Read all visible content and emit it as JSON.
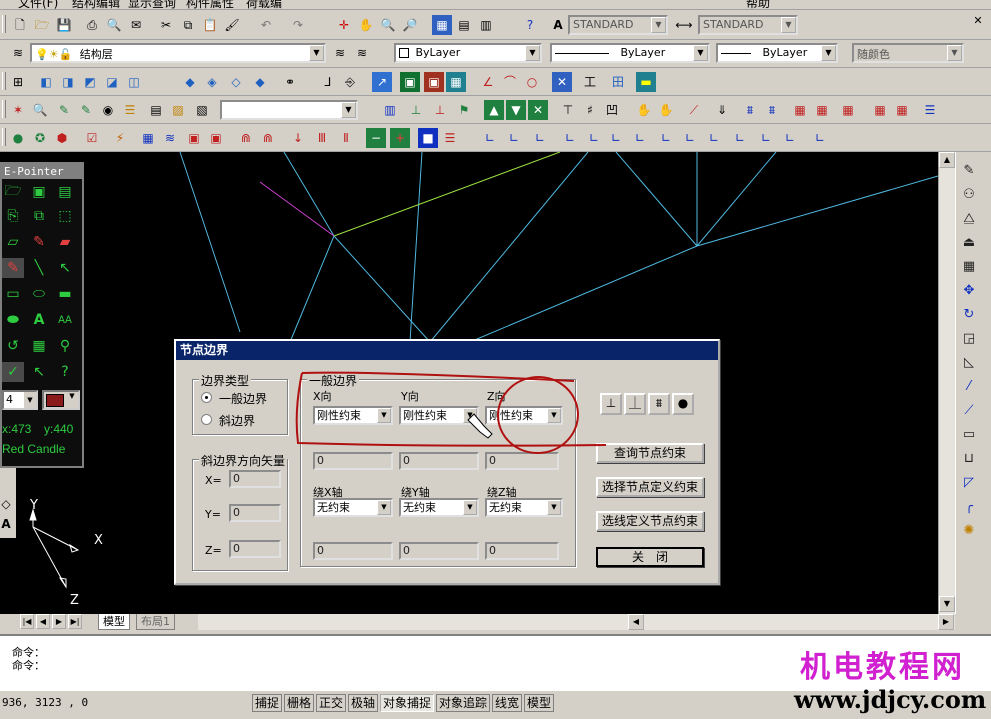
{
  "menubar": {
    "items": [
      "文件(F)",
      "结构编辑",
      "显示查询",
      "构件属性",
      "荷载编",
      "帮助"
    ]
  },
  "toolbar1": {
    "text_style": "STANDARD",
    "dim_style": "STANDARD"
  },
  "toolbar2": {
    "layer": "结构层",
    "color": "ByLayer",
    "linetype": "ByLayer",
    "lineweight": "ByLayer",
    "plotstyle": "随颜色"
  },
  "epointer": {
    "title": "E-Pointer",
    "size_value": "4",
    "coord_x": "x:473",
    "coord_y": "y:440",
    "color_name": "Red Candle"
  },
  "ucs": {
    "x": "X",
    "y": "Y",
    "z": "Z"
  },
  "layout_tabs": [
    "模型",
    "布局1"
  ],
  "command": {
    "line1": "命令：",
    "line2": "命令："
  },
  "status": {
    "coords": "936,    3123 ,  0",
    "buttons": [
      "捕捉",
      "栅格",
      "正交",
      "极轴",
      "对象捕捉",
      "对象追踪",
      "线宽",
      "模型"
    ]
  },
  "dialog": {
    "title": "节点边界",
    "boundary_type": {
      "label": "边界类型",
      "options": [
        "一般边界",
        "斜边界"
      ],
      "selected": "一般边界"
    },
    "vector": {
      "label": "斜边界方向矢量",
      "x_label": "X=",
      "y_label": "Y=",
      "z_label": "Z=",
      "x": "0",
      "y": "0",
      "z": "0"
    },
    "general": {
      "label": "一般边界",
      "x_dir": "X向",
      "y_dir": "Y向",
      "z_dir": "Z向",
      "x_value": "刚性约束",
      "y_value": "刚性约束",
      "z_value": "刚性约束",
      "x_num": "0",
      "y_num": "0",
      "z_num": "0",
      "rx_label": "绕X轴",
      "ry_label": "绕Y轴",
      "rz_label": "绕Z轴",
      "rx_value": "无约束",
      "ry_value": "无约束",
      "rz_value": "无约束",
      "rx_num": "0",
      "ry_num": "0",
      "rz_num": "0"
    },
    "buttons": {
      "query": "查询节点约束",
      "select_define": "选择节点定义约束",
      "line_define": "选线定义节点约束",
      "close": "关　闭"
    },
    "icon_buttons": [
      "fixed-support-icon",
      "pinned-support-icon",
      "roller-support-icon",
      "node-dot-icon"
    ]
  },
  "watermark": {
    "cn": "机电教程网",
    "url": "www.jdjcy.com"
  },
  "colors": {
    "canvas": "#000000",
    "dialog_title": "#0a246a",
    "annotation": "#b01010",
    "watermark_cn": "#d020d0",
    "wire": "#4fb8e0"
  }
}
